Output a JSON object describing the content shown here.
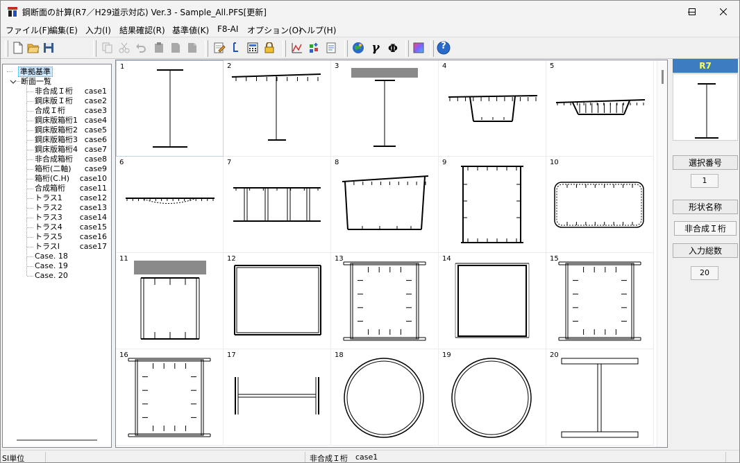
{
  "window": {
    "title": "鋼断面の計算(R7／H29道示対応) Ver.3 - Sample_All.PFS[更新]"
  },
  "menu": [
    "ファイル(F)",
    "編集(E)",
    "入力(I)",
    "結果確認(R)",
    "基準値(K)",
    "F8-AI",
    "オプション(O)",
    "ヘルプ(H)"
  ],
  "toolbar": {
    "gamma_glyph": "γ",
    "phi_glyph": "Φ",
    "help_glyph": "?"
  },
  "tree": {
    "root_standard": "準拠基準",
    "root_list": "断面一覧",
    "items": [
      {
        "name": "非合成Ｉ桁",
        "case": "case1"
      },
      {
        "name": "鋼床版Ｉ桁",
        "case": "case2"
      },
      {
        "name": "合成Ｉ桁",
        "case": "case3"
      },
      {
        "name": "鋼床版箱桁1",
        "case": "case4"
      },
      {
        "name": "鋼床版箱桁2",
        "case": "case5"
      },
      {
        "name": "鋼床版箱桁3",
        "case": "case6"
      },
      {
        "name": "鋼床版箱桁4",
        "case": "case7"
      },
      {
        "name": "非合成箱桁",
        "case": "case8"
      },
      {
        "name": "箱桁(二軸)",
        "case": "case9"
      },
      {
        "name": "箱桁(C.H)",
        "case": "case10"
      },
      {
        "name": "合成箱桁",
        "case": "case11"
      },
      {
        "name": "トラス1",
        "case": "case12"
      },
      {
        "name": "トラス2",
        "case": "case13"
      },
      {
        "name": "トラス3",
        "case": "case14"
      },
      {
        "name": "トラス4",
        "case": "case15"
      },
      {
        "name": "トラス5",
        "case": "case16"
      },
      {
        "name": "トラスI",
        "case": "case17"
      },
      {
        "name": "Case. 18",
        "case": ""
      },
      {
        "name": "Case. 19",
        "case": ""
      },
      {
        "name": "Case. 20",
        "case": ""
      }
    ]
  },
  "grid": {
    "numbers": [
      "1",
      "2",
      "3",
      "4",
      "5",
      "6",
      "7",
      "8",
      "9",
      "10",
      "11",
      "12",
      "13",
      "14",
      "15",
      "16",
      "17",
      "18",
      "19",
      "20"
    ]
  },
  "right_panel": {
    "standard": "R7",
    "select_no_label": "選択番号",
    "select_no_value": "1",
    "shape_name_label": "形状名称",
    "shape_name_value": "非合成Ｉ桁",
    "total_label": "入力総数",
    "total_value": "20"
  },
  "status": {
    "units": "SI単位",
    "section_name": "非合成Ｉ桁",
    "case": "case1"
  }
}
